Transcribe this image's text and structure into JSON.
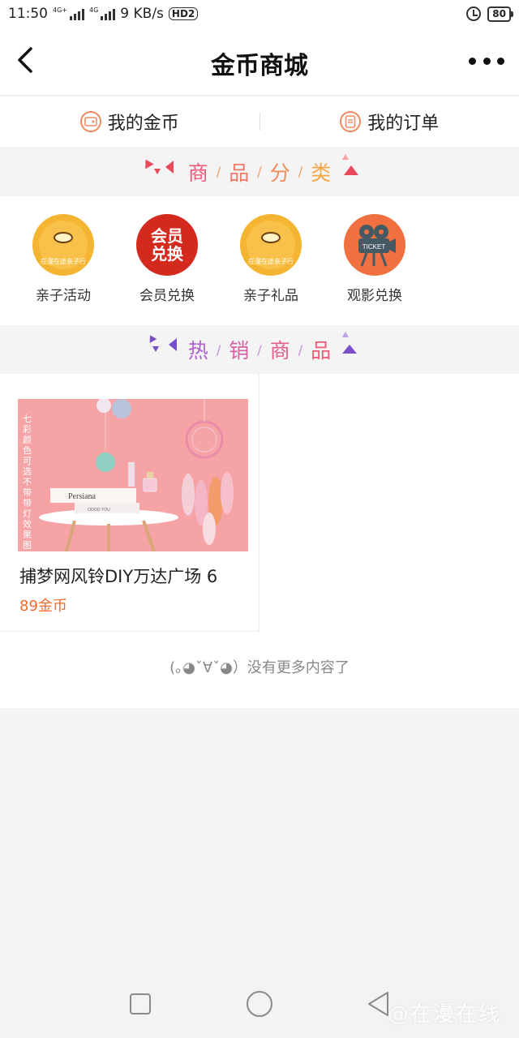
{
  "status_bar": {
    "time": "11:50",
    "net1": "4G+",
    "net2": "4G",
    "speed": "9 KB/s",
    "hd": "HD2",
    "battery": "80"
  },
  "nav": {
    "title": "金币商城",
    "back_icon": "chevron-left-icon",
    "more_icon": "more-dots-icon"
  },
  "tabs": {
    "coins_label": "我的金币",
    "orders_label": "我的订单"
  },
  "sections": {
    "category_chars": [
      "商",
      "品",
      "分",
      "类"
    ],
    "hot_chars": [
      "热",
      "销",
      "商",
      "品"
    ],
    "separator": "/"
  },
  "categories": [
    {
      "label": "亲子活动",
      "badge_text": "在漫在途亲子行"
    },
    {
      "label": "会员兑换",
      "badge_text_top": "会员",
      "badge_text_bottom": "兑换"
    },
    {
      "label": "亲子礼品",
      "badge_text": "在漫在途亲子行"
    },
    {
      "label": "观影兑换",
      "badge_text": "TICKET"
    }
  ],
  "products": [
    {
      "name": "捕梦网风铃DIY万达广场 6",
      "price": "89金币",
      "image_text_side": "七彩颜色可选不带带灯效果图",
      "image_book_title": "Persiana",
      "image_book2": "OOOO YOU"
    }
  ],
  "footer_text": "(｡◕ˇ∀ˇ◕）没有更多内容了",
  "watermark": "@在漫在线",
  "colors": {
    "accent": "#f06a2c",
    "category_heading": "#ee6a7a",
    "hot_heading": "#b05fd0"
  }
}
